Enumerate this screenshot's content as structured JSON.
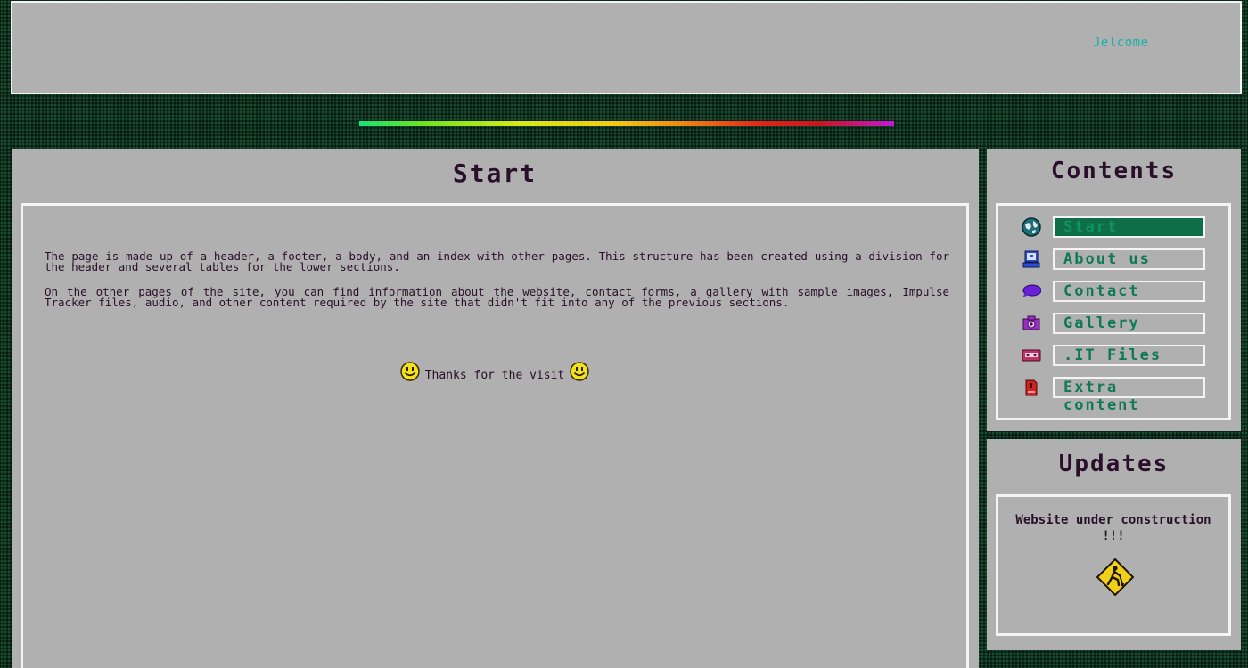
{
  "header": {
    "welcome_text": "Jelcome"
  },
  "main": {
    "title": "Start",
    "paragraphs": [
      "The page is made up of a header, a footer, a body, and an index with other pages. This structure has been created using a division for the header and several tables for the lower sections.",
      "On the other pages of the site, you can find information about the website, contact forms, a gallery with sample images, Impulse Tracker files, audio, and other content required by the site that didn't fit into any of the previous sections."
    ],
    "thanks_text": "Thanks for the visit"
  },
  "contents": {
    "title": "Contents",
    "items": [
      {
        "label": "Start",
        "icon": "globe-icon",
        "active": true
      },
      {
        "label": "About us",
        "icon": "computer-icon",
        "active": false
      },
      {
        "label": "Contact",
        "icon": "speech-bubble-icon",
        "active": false
      },
      {
        "label": "Gallery",
        "icon": "camera-icon",
        "active": false
      },
      {
        "label": ".IT Files",
        "icon": "cassette-icon",
        "active": false
      },
      {
        "label": "Extra content",
        "icon": "memory-card-icon",
        "active": false
      }
    ]
  },
  "updates": {
    "title": "Updates",
    "line1": "Website under construction",
    "line2": "!!!",
    "icon": "under-construction-icon"
  },
  "colors": {
    "panel_bg": "#b0b0b0",
    "panel_border": "#f4f4f4",
    "title_text": "#2a0f2a",
    "nav_text": "#0f7a55",
    "nav_active_bg": "#0d6e48",
    "welcome_text": "#17b3a8",
    "page_bg": "#0c2a1a"
  }
}
